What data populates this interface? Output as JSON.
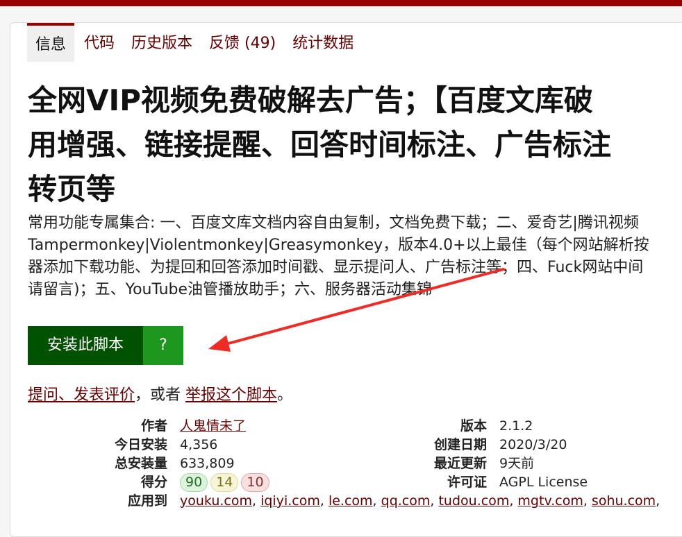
{
  "tabs": [
    "信息",
    "代码",
    "历史版本",
    "反馈 (49)",
    "统计数据"
  ],
  "title_lines": [
    "全网VIP视频免费破解去广告；【百度文库破",
    "用增强、链接提醒、回答时间标注、广告标注",
    "转页等"
  ],
  "description_lines": [
    "常用功能专属集合: 一、百度文库文档内容自由复制，文档免费下载；二、爱奇艺|腾讯视频",
    "Tampermonkey|Violentmonkey|Greasymonkey，版本4.0+以上最佳（每个网站解析按",
    "器添加下载功能、为提回和回答添加时间戳、显示提问人、广告标注等；四、Fuck网站中间",
    "请留言)；五、YouTube油管播放助手；六、服务器活动集锦"
  ],
  "install": {
    "label": "安装此脚本",
    "help": "?"
  },
  "feedback": {
    "ask": "提问、发表评价",
    "middle": "，或者 ",
    "report": "举报这个脚本",
    "end": "。"
  },
  "meta_left": {
    "author_label": "作者",
    "author": "人鬼情未了",
    "daily_label": "今日安装",
    "daily": "4,356",
    "total_label": "总安装量",
    "total": "633,809",
    "score_label": "得分",
    "score_good": "90",
    "score_ok": "14",
    "score_bad": "10",
    "applies_label": "应用到"
  },
  "meta_right": {
    "version_label": "版本",
    "version": "2.1.2",
    "created_label": "创建日期",
    "created": "2020/3/20",
    "updated_label": "最近更新",
    "updated": "9天前",
    "license_label": "许可证",
    "license": "AGPL License"
  },
  "applies_to": [
    "youku.com",
    "iqiyi.com",
    "le.com",
    "qq.com",
    "tudou.com",
    "mgtv.com",
    "sohu.com"
  ],
  "colors": {
    "brand": "#990000",
    "link": "#670000",
    "install": "#005200",
    "install_help": "#1e971e",
    "arrow": "#ee2b24"
  }
}
